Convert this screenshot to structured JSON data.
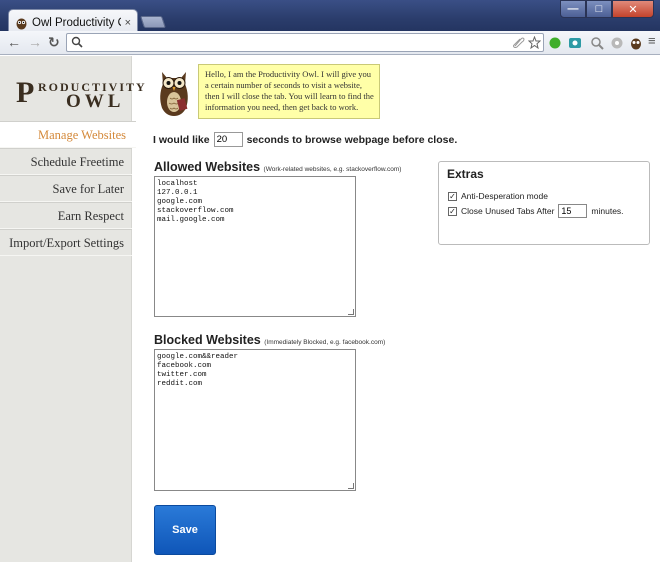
{
  "browser": {
    "tab_title": "Owl Productivity Opt",
    "tab_close": "×",
    "address_value": "",
    "window_controls": {
      "minimize": "—",
      "maximize": "□",
      "close": "✕"
    }
  },
  "sidebar": {
    "logo_big": "P",
    "logo_line1": "RODUCTIVITY",
    "logo_line2": "OWL",
    "items": [
      {
        "label": "Manage Websites",
        "active": true
      },
      {
        "label": "Schedule Freetime"
      },
      {
        "label": "Save for Later"
      },
      {
        "label": "Earn Respect"
      },
      {
        "label": "Import/Export Settings"
      }
    ]
  },
  "speech": {
    "text": "Hello, I am the Productivity Owl. I will give you a certain number of seconds to visit a website, then I will close the tab. You will learn to find the information you need, then get back to work."
  },
  "browse": {
    "prefix": "I would like",
    "seconds": "20",
    "suffix": "seconds to browse webpage before close."
  },
  "allowed": {
    "title": "Allowed Websites",
    "hint": "(Work-related websites, e.g. stackoverflow.com)",
    "value": "localhost\n127.0.0.1\ngoogle.com\nstackoverflow.com\nmail.google.com"
  },
  "blocked": {
    "title": "Blocked Websites",
    "hint": "(Immediately Blocked, e.g. facebook.com)",
    "value": "google.com&&reader\nfacebook.com\ntwitter.com\nreddit.com"
  },
  "extras": {
    "title": "Extras",
    "anti_desperation": {
      "label": "Anti-Desperation mode",
      "checked": true
    },
    "close_unused": {
      "label": "Close Unused Tabs After",
      "value": "15",
      "suffix": "minutes.",
      "checked": true
    }
  },
  "save_label": "Save",
  "colors": {
    "active_nav": "#d4893a",
    "save_button": "#1565c8",
    "speech_bg": "#ffffa8"
  }
}
